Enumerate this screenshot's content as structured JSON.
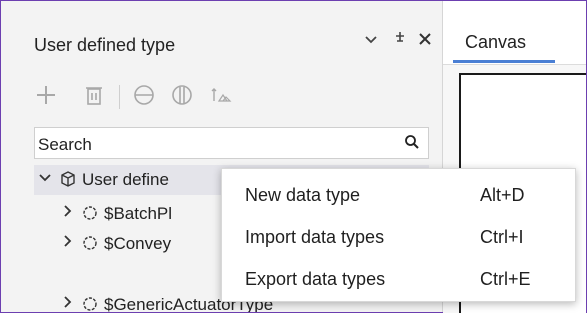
{
  "panel": {
    "title": "User defined type",
    "header_icons": [
      "chevron-down-icon",
      "pin-icon",
      "close-icon"
    ],
    "toolbar_icons": [
      "add-icon",
      "delete-icon",
      "collapse-icon",
      "expand-icon",
      "sort-icon"
    ]
  },
  "search": {
    "placeholder": "Search"
  },
  "tree": {
    "root_label": "User define",
    "children": [
      {
        "label": "$BatchPl"
      },
      {
        "label": "$Convey"
      },
      {
        "label": "$GenericActuatorType"
      }
    ]
  },
  "tabs": [
    {
      "label": "Canvas",
      "active": true
    }
  ],
  "context_menu": {
    "items": [
      {
        "label": "New data type",
        "shortcut": "Alt+D"
      },
      {
        "label": "Import data types",
        "shortcut": "Ctrl+I"
      },
      {
        "label": "Export data types",
        "shortcut": "Ctrl+E"
      }
    ]
  },
  "colors": {
    "frame": "#6c3fb0",
    "tab_underline": "#4a7fd4",
    "selected_row": "#e4e4ea"
  }
}
